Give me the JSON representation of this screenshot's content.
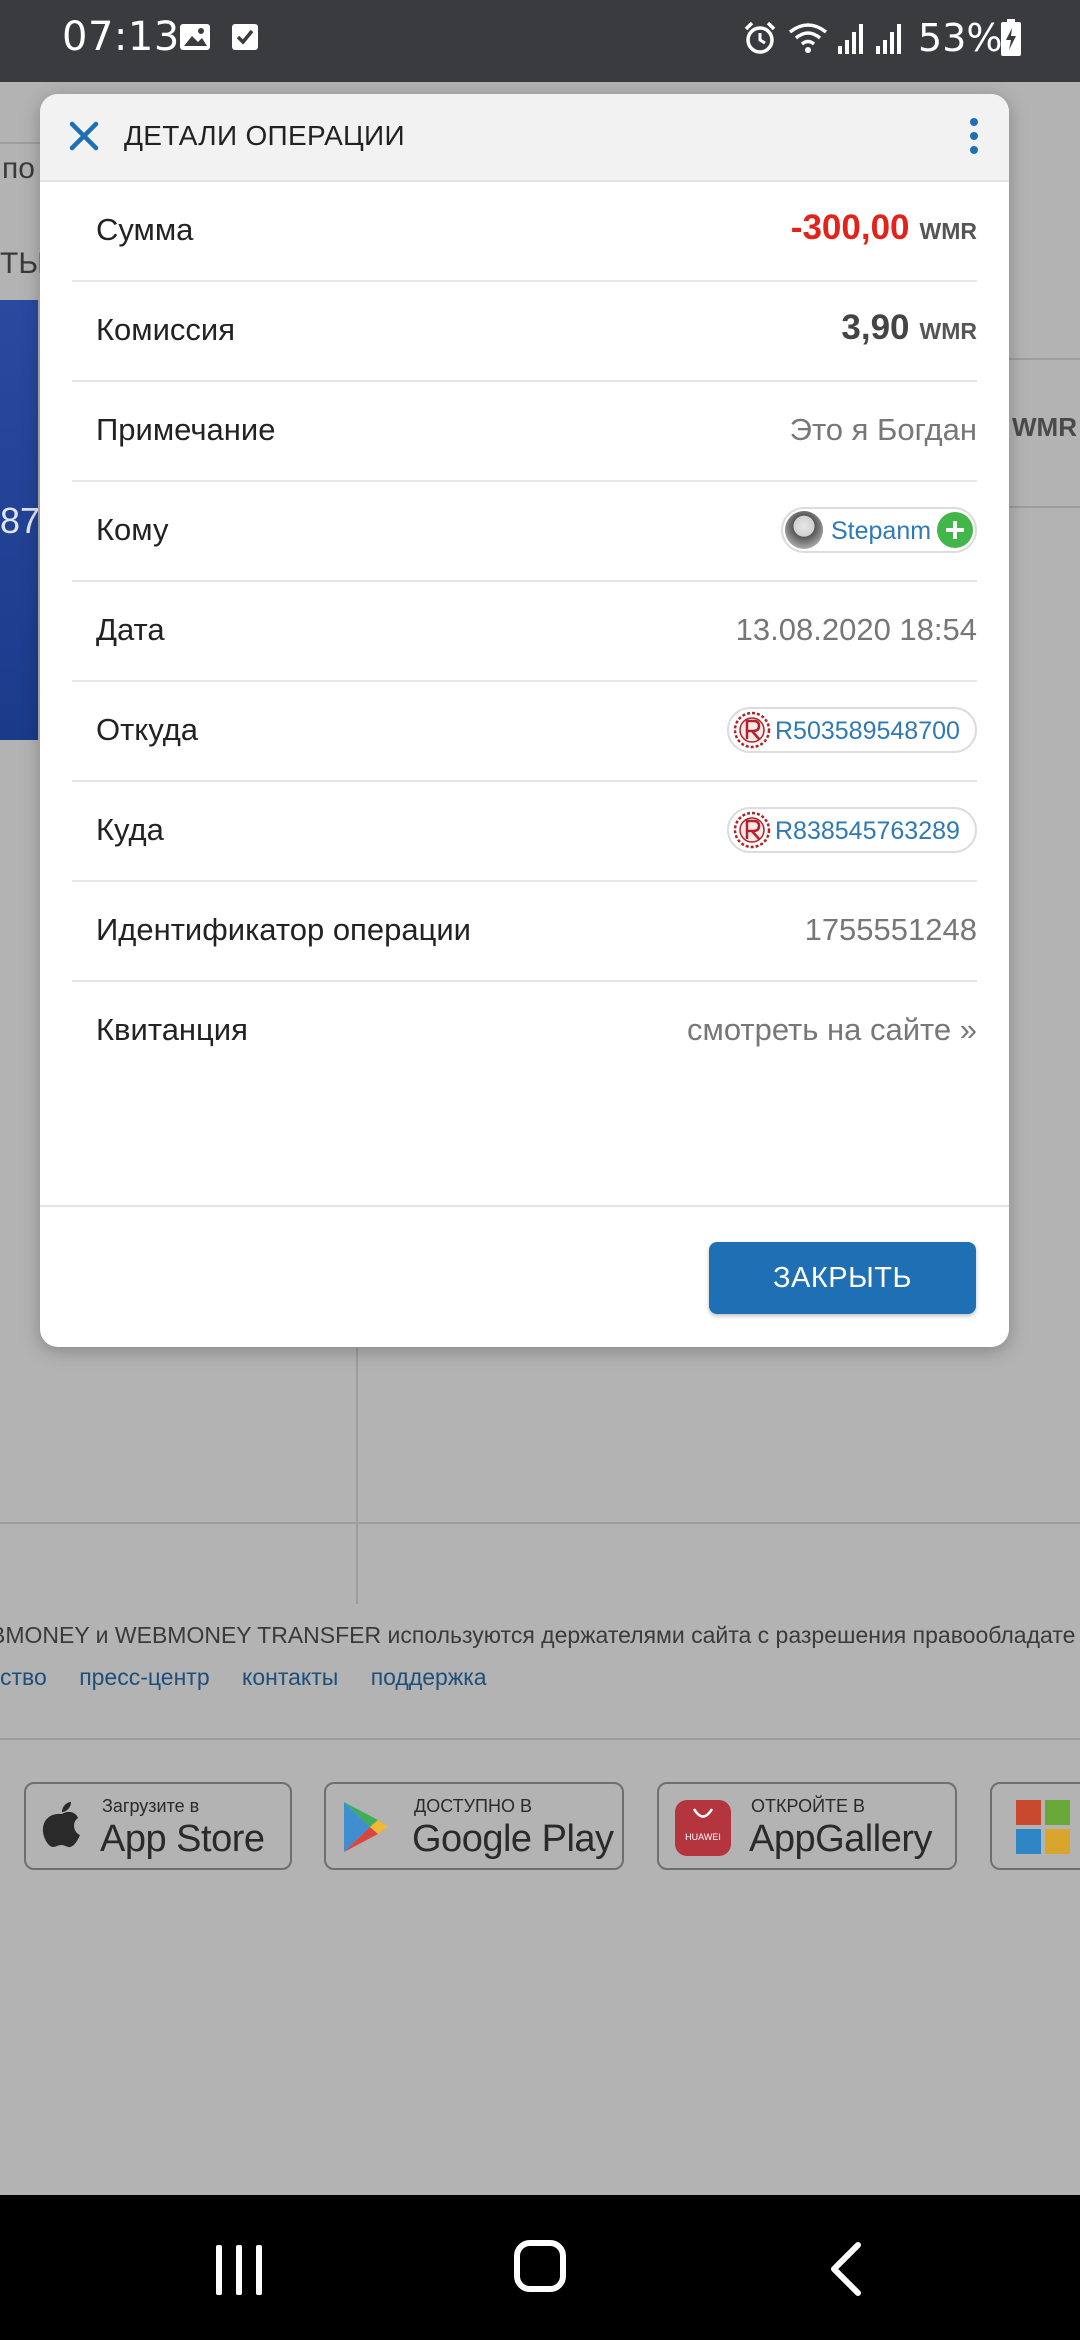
{
  "status_bar": {
    "time": "07:13",
    "battery": "53%"
  },
  "background": {
    "left_fragments": [
      "по",
      "ТЫ",
      "87"
    ],
    "right_fragment": "WMR",
    "footer_text": "BMONEY и WEBMONEY TRANSFER используются держателями сайта с разрешения правообладате",
    "footer_links": [
      "ство",
      "пресс-центр",
      "контакты",
      "поддержка"
    ],
    "stores": [
      {
        "small": "Загрузите в",
        "big": "App Store"
      },
      {
        "small": "ДОСТУПНО В",
        "big": "Google Play"
      },
      {
        "small": "ОТКРОЙТЕ В",
        "big": "AppGallery",
        "brand": "HUAWEI"
      }
    ]
  },
  "dialog": {
    "title": "ДЕТАЛИ ОПЕРАЦИИ",
    "rows": {
      "amount": {
        "label": "Сумма",
        "value": "-300,00",
        "currency": "WMR"
      },
      "fee": {
        "label": "Комиссия",
        "value": "3,90",
        "currency": "WMR"
      },
      "note": {
        "label": "Примечание",
        "value": "Это я Богдан"
      },
      "to": {
        "label": "Кому",
        "value": "Stepanm"
      },
      "date": {
        "label": "Дата",
        "value": "13.08.2020 18:54"
      },
      "from_purse": {
        "label": "Откуда",
        "value": "R503589548700"
      },
      "to_purse": {
        "label": "Куда",
        "value": "R838545763289"
      },
      "op_id": {
        "label": "Идентификатор операции",
        "value": "1755551248"
      },
      "receipt": {
        "label": "Квитанция",
        "value": "смотреть на сайте »"
      }
    },
    "close_label": "ЗАКРЫТЬ"
  },
  "colors": {
    "accent": "#1e6fb4",
    "negative": "#e3231b",
    "add_green": "#43b649"
  }
}
